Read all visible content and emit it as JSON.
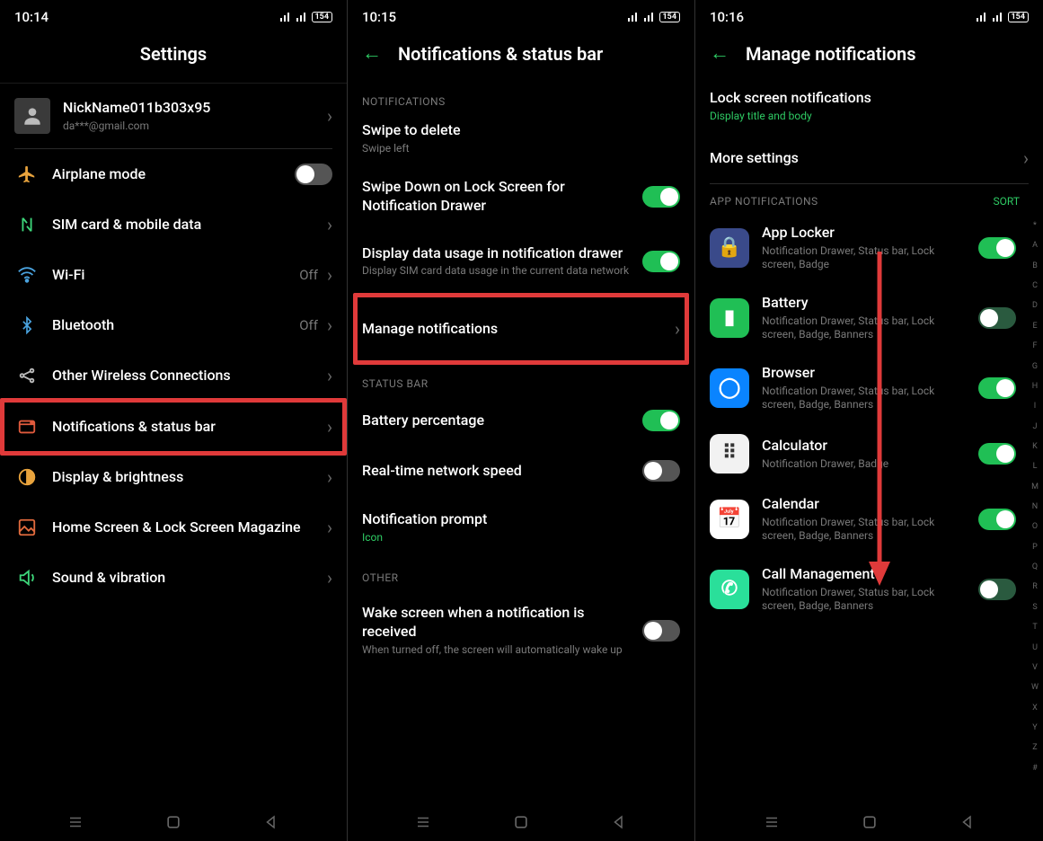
{
  "screen1": {
    "time": "10:14",
    "battery_label": "154",
    "title": "Settings",
    "profile": {
      "name": "NickName011b303x95",
      "email": "da***@gmail.com"
    },
    "airplane": "Airplane mode",
    "sim": "SIM card & mobile data",
    "wifi": "Wi-Fi",
    "wifi_state": "Off",
    "bluetooth": "Bluetooth",
    "bluetooth_state": "Off",
    "other_wireless": "Other Wireless Connections",
    "notifications_status_bar": "Notifications & status bar",
    "display": "Display & brightness",
    "home_lock": "Home Screen & Lock Screen Magazine",
    "sound": "Sound & vibration"
  },
  "screen2": {
    "time": "10:15",
    "battery_label": "154",
    "title": "Notifications & status bar",
    "section_notifications": "NOTIFICATIONS",
    "swipe_delete": "Swipe to delete",
    "swipe_delete_sub": "Swipe left",
    "swipe_down": "Swipe Down on Lock Screen for Notification Drawer",
    "data_usage": "Display data usage in notification drawer",
    "data_usage_sub": "Display SIM card data usage in the current data network",
    "manage": "Manage notifications",
    "section_status_bar": "STATUS BAR",
    "battery_pct": "Battery percentage",
    "network_speed": "Real-time network speed",
    "notif_prompt": "Notification prompt",
    "notif_prompt_sub": "Icon",
    "section_other": "OTHER",
    "wake_screen": "Wake screen when a notification is received",
    "wake_screen_sub": "When turned off, the screen will automatically wake up"
  },
  "screen3": {
    "time": "10:16",
    "battery_label": "154",
    "title": "Manage notifications",
    "lock_screen": "Lock screen notifications",
    "lock_screen_sub": "Display title and body",
    "more_settings": "More settings",
    "section_app": "APP NOTIFICATIONS",
    "sort": "SORT",
    "apps": [
      {
        "name": "App Locker",
        "sub": "Notification Drawer, Status bar, Lock screen, Badge",
        "icon_bg": "#3a4a8a",
        "icon_txt": "🔒"
      },
      {
        "name": "Battery",
        "sub": "Notification Drawer, Status bar, Lock screen, Badge, Banners",
        "icon_bg": "#20bf55",
        "icon_txt": "▮"
      },
      {
        "name": "Browser",
        "sub": "Notification Drawer, Status bar, Lock screen, Badge, Banners",
        "icon_bg": "#0a84ff",
        "icon_txt": "◯"
      },
      {
        "name": "Calculator",
        "sub": "Notification Drawer, Badge",
        "icon_bg": "#f2f2f2",
        "icon_txt": "⠿"
      },
      {
        "name": "Calendar",
        "sub": "Notification Drawer, Status bar, Lock screen, Badge, Banners",
        "icon_bg": "#ffffff",
        "icon_txt": "📅"
      },
      {
        "name": "Call Management",
        "sub": "Notification Drawer, Status bar, Lock screen, Badge, Banners",
        "icon_bg": "#2adf9a",
        "icon_txt": "✆"
      }
    ],
    "alpha": [
      "*",
      "A",
      "B",
      "C",
      "D",
      "E",
      "F",
      "G",
      "H",
      "I",
      "J",
      "K",
      "L",
      "M",
      "N",
      "O",
      "P",
      "Q",
      "R",
      "S",
      "T",
      "U",
      "V",
      "W",
      "X",
      "Y",
      "Z",
      "#"
    ]
  }
}
